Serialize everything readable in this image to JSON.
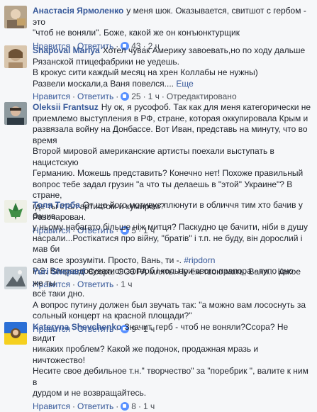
{
  "actions": {
    "like": "Нравится",
    "reply": "Ответить",
    "edited": "Отредактировано",
    "more": "Еще"
  },
  "comments": [
    {
      "author": "Анастасія Ярмоленко",
      "lines": [
        "у меня шок. Оказывается, свитшот с гербом - это",
        "\"чтоб не воняли\". Боже, какой же он конъюнктурщик"
      ],
      "likes": "43",
      "time": "2 ч"
    },
    {
      "author": "Shapoval Mariya",
      "lines": [
        "Хотел чувак Америку завоевать,но по ходу дальше",
        "Рязанской птицефабрики не уедешь.",
        "В крокус сити каждый месяц на хрен Коллабы не нужны)",
        "Развели москали,а Ваня повелся...."
      ],
      "likes": "25",
      "time": "1 ч"
    },
    {
      "author": "Oleksii Frantsuz",
      "lines": [
        "Ну ок, я русофоб. Так как для меня категорически не",
        "приемлемо выступления в РФ, стране, которая оккупировала Крым и",
        "развязала войну на Донбассе. Вот Иван, представь на минуту, что во время",
        "Второй мировой американские артисты поехали выступать в нацистскую",
        "Германию. Можешь представить? Конечно нет! Похоже правильный",
        "вопрос тебе задал грузин \"а что ты делаешь в \"этой\" Украине\"? В стране,",
        "где ты стал артистом и кумиром?",
        "Разочарован."
      ],
      "likes": "5",
      "time": "1 ч"
    },
    {
      "author": "Толя Торба",
      "lines": [
        "От що його мотивує плюнути в обличчя тим хто бачив у бачив",
        "у ньому набагато більше ніж митця? Паскудно це бачити, ніби в душу",
        "насрали...Ростікатися про війну, \"братів\" і т.п. не буду, він дорослий і мав би",
        "сам все зрозуміти. Просто, Вань, ти -.",
        "P.S. Виправдовуватися за герб і кольори свого прапора - тупо дно"
      ],
      "hashtag": "#ripdorn",
      "time": "1 ч"
    },
    {
      "author": "Yuri Shepard",
      "lines": [
        "Ссора. ССОРА млять. Ну ёж твою мать, Ваня... Какое же ты",
        "всё таки дно.",
        "А вопрос путину должен был звучать так: \"а можно вам лососнуть за",
        "сольный концерт на красной площади?\""
      ],
      "likes": "9",
      "time": "1 ч"
    },
    {
      "author": "Kateryna Shevchenko",
      "lines": [
        "Значит, герб - чтоб не воняли?Ссора? Не видит",
        "никаких проблем? Какой же подонок, продажная мразь и ничтожество!",
        "Несите свое дебильное т.н.\" творчество\" за \"поребрик \", валите к ним в",
        "дурдом и не возвращайтесь."
      ],
      "likes": "8",
      "time": "1 ч"
    }
  ]
}
